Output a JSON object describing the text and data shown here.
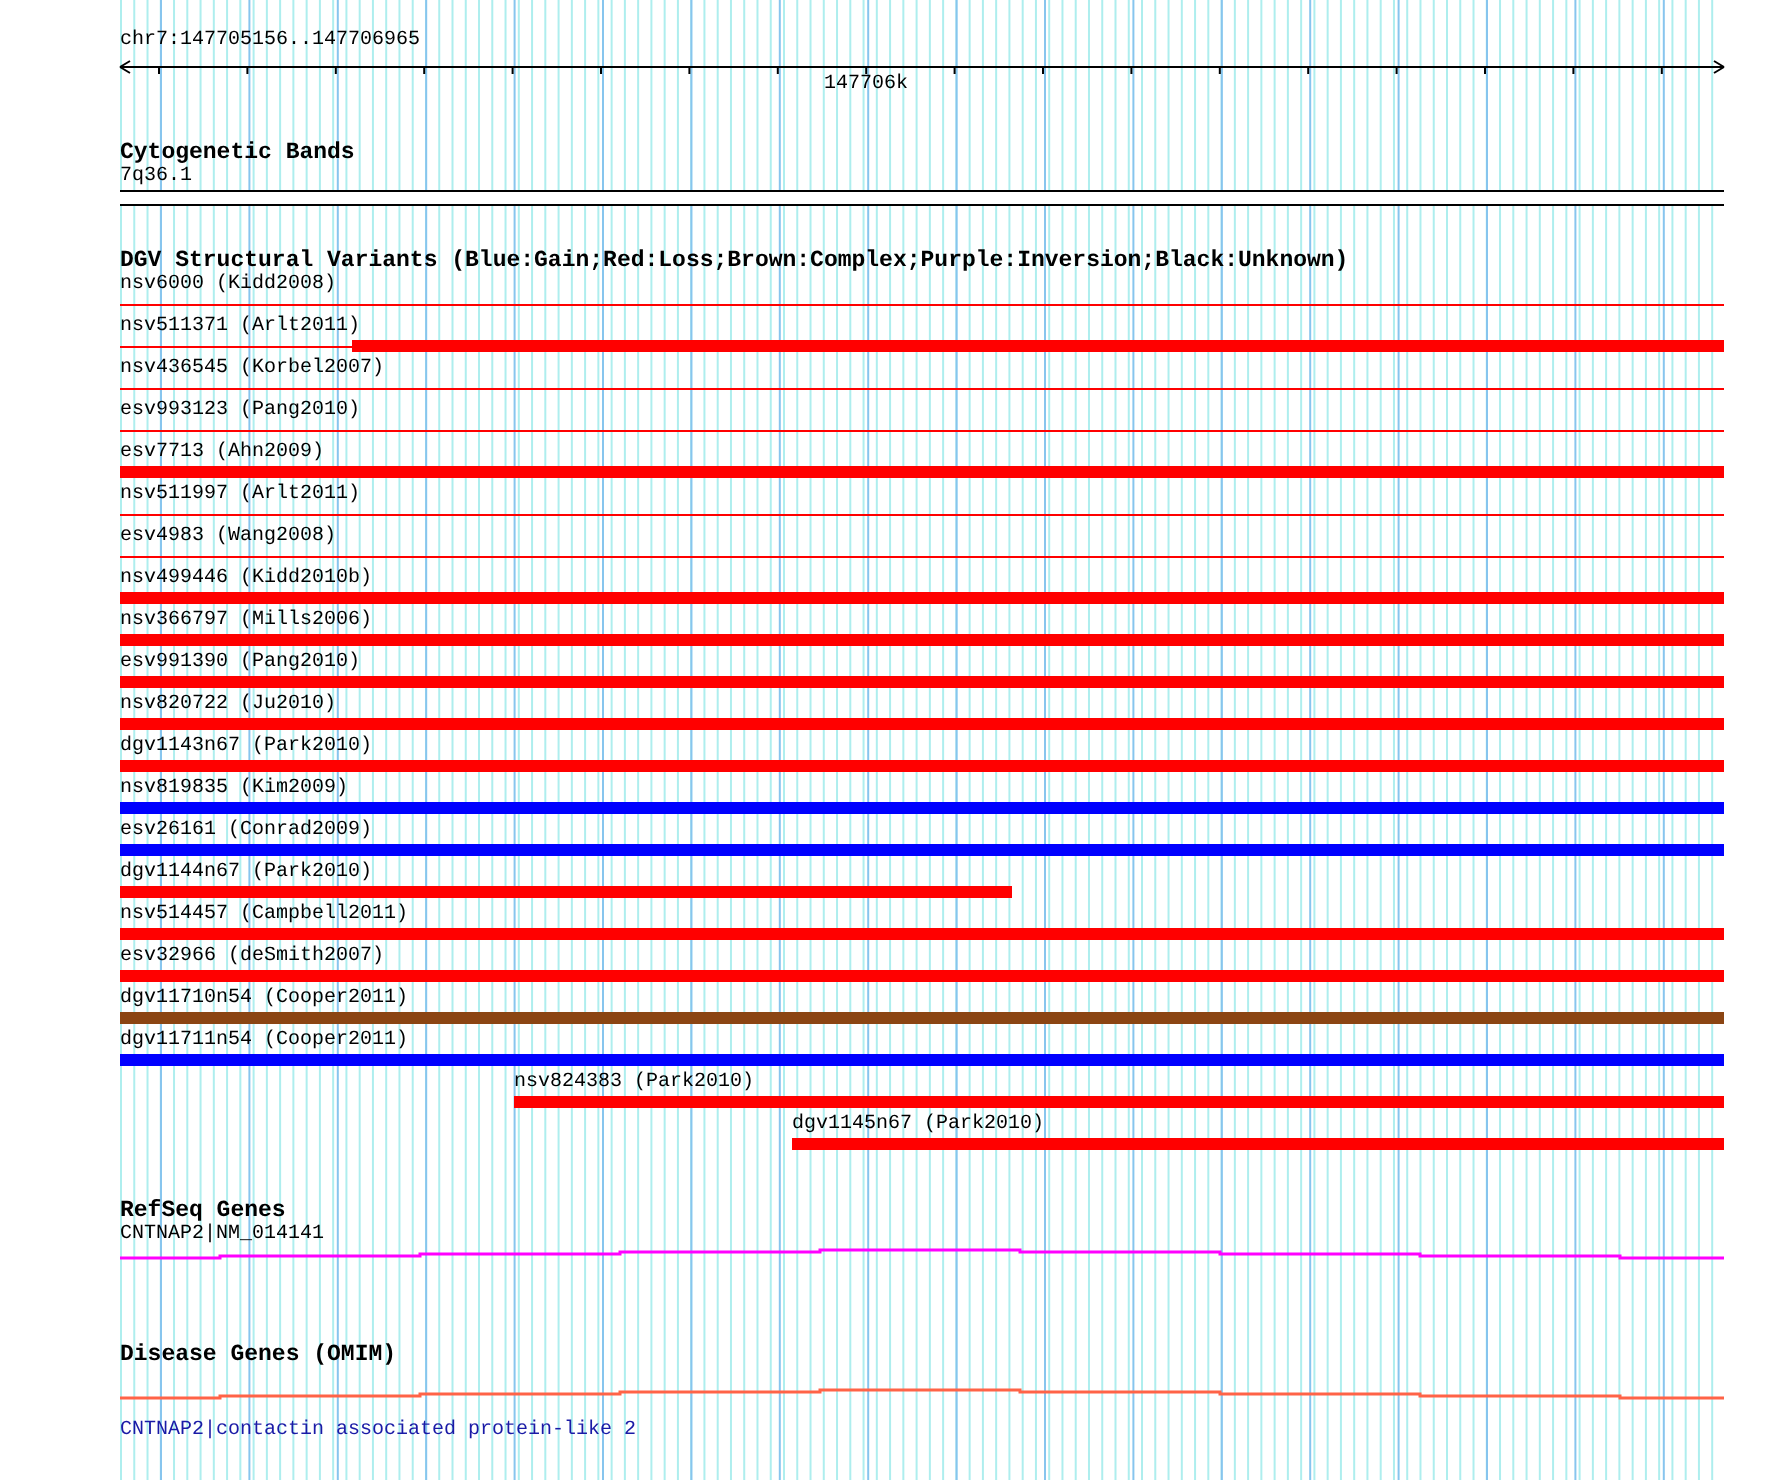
{
  "ruler": {
    "region": "chr7:147705156..147706965",
    "tick_label": "147706k"
  },
  "cytogenetic_bands": {
    "title": "Cytogenetic Bands",
    "label": "7q36.1"
  },
  "dgv": {
    "title": "DGV Structural Variants (Blue:Gain;Red:Loss;Brown:Complex;Purple:Inversion;Black:Unknown)",
    "variants": [
      {
        "label": "nsv6000 (Kidd2008)",
        "color": "#ff0000",
        "kind": "thin"
      },
      {
        "label": "nsv511371 (Arlt2011)",
        "color": "#ff0000",
        "kind": "split"
      },
      {
        "label": "nsv436545 (Korbel2007)",
        "color": "#ff0000",
        "kind": "thin"
      },
      {
        "label": "esv993123 (Pang2010)",
        "color": "#ff0000",
        "kind": "thin"
      },
      {
        "label": "esv7713 (Ahn2009)",
        "color": "#ff0000",
        "kind": "thick"
      },
      {
        "label": "nsv511997 (Arlt2011)",
        "color": "#ff0000",
        "kind": "thin"
      },
      {
        "label": "esv4983 (Wang2008)",
        "color": "#ff0000",
        "kind": "thin"
      },
      {
        "label": "nsv499446 (Kidd2010b)",
        "color": "#ff0000",
        "kind": "thick"
      },
      {
        "label": "nsv366797 (Mills2006)",
        "color": "#ff0000",
        "kind": "thick"
      },
      {
        "label": "esv991390 (Pang2010)",
        "color": "#ff0000",
        "kind": "thick"
      },
      {
        "label": "nsv820722 (Ju2010)",
        "color": "#ff0000",
        "kind": "thick"
      },
      {
        "label": "dgv1143n67 (Park2010)",
        "color": "#ff0000",
        "kind": "thick"
      },
      {
        "label": "nsv819835 (Kim2009)",
        "color": "#0000ff",
        "kind": "thick"
      },
      {
        "label": "esv26161 (Conrad2009)",
        "color": "#0000ff",
        "kind": "thick"
      },
      {
        "label": "dgv1144n67 (Park2010)",
        "color": "#ff0000",
        "kind": "thick"
      },
      {
        "label": "nsv514457 (Campbell2011)",
        "color": "#ff0000",
        "kind": "thick"
      },
      {
        "label": "esv32966 (deSmith2007)",
        "color": "#ff0000",
        "kind": "thick"
      },
      {
        "label": "dgv11710n54 (Cooper2011)",
        "color": "#8b4513",
        "kind": "thick"
      },
      {
        "label": "dgv11711n54 (Cooper2011)",
        "color": "#0000ff",
        "kind": "thick"
      },
      {
        "label": "nsv824383 (Park2010)",
        "color": "#ff0000",
        "kind": "thick"
      },
      {
        "label": "dgv1145n67 (Park2010)",
        "color": "#ff0000",
        "kind": "thick"
      }
    ]
  },
  "refseq_genes": {
    "title": "RefSeq Genes",
    "label": "CNTNAP2|NM_014141"
  },
  "disease_genes": {
    "title": "Disease Genes (OMIM)",
    "label": "CNTNAP2|contactin associated protein-like 2"
  }
}
